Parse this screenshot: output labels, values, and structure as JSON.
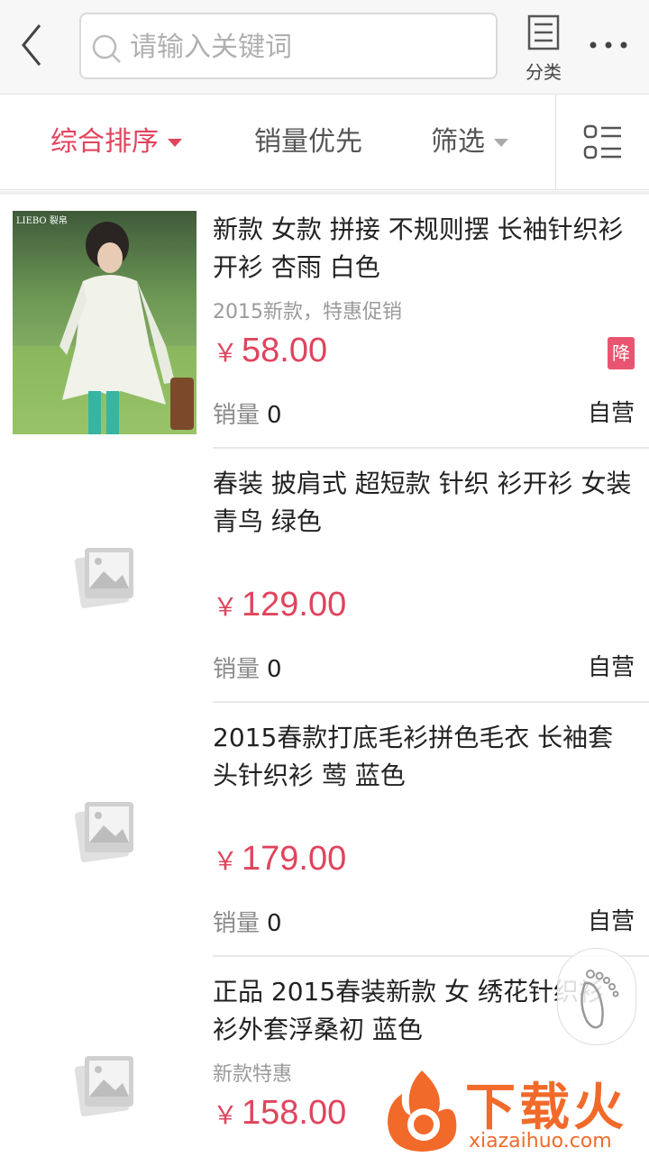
{
  "search": {
    "placeholder": "请输入关键词"
  },
  "header": {
    "category_label": "分类"
  },
  "sort_tabs": [
    {
      "label": "综合排序",
      "active": true
    },
    {
      "label": "销量优先",
      "active": false
    },
    {
      "label": "筛选",
      "active": false
    }
  ],
  "products": [
    {
      "title": "新款 女款 拼接 不规则摆 长袖针织衫开衫 杏雨 白色",
      "subtitle": "2015新款，特惠促销",
      "currency": "￥",
      "price": "58.00",
      "sales_label": "销量",
      "sales": "0",
      "self_op": "自营",
      "badge": "降",
      "thumb_logo": "LIEBO 裂帛"
    },
    {
      "title": "春装 披肩式 超短款 针织 衫开衫 女装 青鸟 绿色",
      "subtitle": "",
      "currency": "￥",
      "price": "129.00",
      "sales_label": "销量",
      "sales": "0",
      "self_op": "自营"
    },
    {
      "title": "2015春款打底毛衫拼色毛衣 长袖套头针织衫 莺 蓝色",
      "subtitle": "",
      "currency": "￥",
      "price": "179.00",
      "sales_label": "销量",
      "sales": "0",
      "self_op": "自营"
    },
    {
      "title": "正品 2015春装新款 女 绣花针织衫 衫外套浮桑初 蓝色",
      "subtitle": "新款特惠",
      "currency": "￥",
      "price": "158.00"
    }
  ],
  "watermark": {
    "text": "下载火",
    "domain": "xiazaihuo.com"
  },
  "colors": {
    "accent": "#e0445d",
    "badge": "#e95571"
  }
}
